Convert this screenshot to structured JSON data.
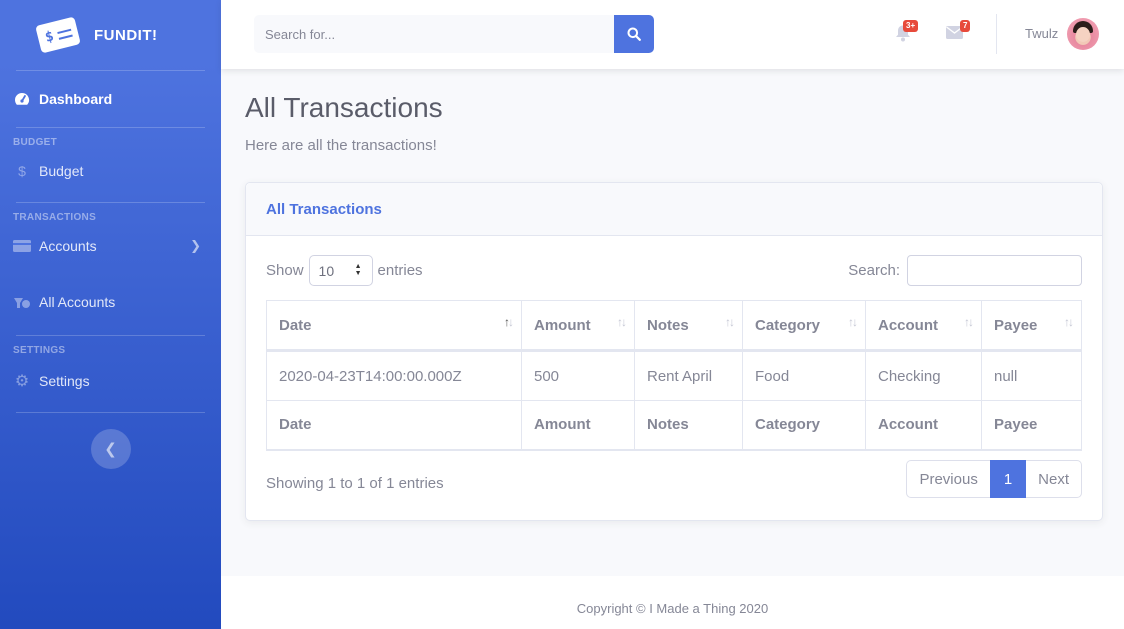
{
  "brand": {
    "name": "FUNDIT!",
    "logo_symbol": "$"
  },
  "sidebar": {
    "dashboard": "Dashboard",
    "heading_budget": "BUDGET",
    "budget": "Budget",
    "heading_transactions": "TRANSACTIONS",
    "accounts": "Accounts",
    "all_accounts": "All Accounts",
    "heading_settings": "SETTINGS",
    "settings": "Settings"
  },
  "topbar": {
    "search_placeholder": "Search for...",
    "alerts_badge": "3+",
    "messages_badge": "7",
    "user_name": "Twulz"
  },
  "page": {
    "title": "All Transactions",
    "subtitle": "Here are all the transactions!"
  },
  "card": {
    "header": "All Transactions",
    "show_label": "Show",
    "entries_value": "10",
    "entries_label": "entries",
    "search_label": "Search:",
    "columns": [
      "Date",
      "Amount",
      "Notes",
      "Category",
      "Account",
      "Payee"
    ],
    "rows": [
      [
        "2020-04-23T14:00:00.000Z",
        "500",
        "Rent April",
        "Food",
        "Checking",
        "null"
      ]
    ],
    "info": "Showing 1 to 1 of 1 entries",
    "pager": {
      "previous": "Previous",
      "current": "1",
      "next": "Next"
    }
  },
  "footer": {
    "copyright": "Copyright © I Made a Thing 2020"
  },
  "colors": {
    "primary": "#4e73df",
    "danger": "#e74a3b",
    "text": "#858796"
  },
  "icons": {
    "dashboard": "tachometer-icon",
    "budget": "dollar-icon",
    "accounts": "credit-card-icon",
    "all_accounts": "piggy-icon",
    "settings": "gear-icon",
    "search": "search-icon",
    "alerts": "bell-icon",
    "messages": "envelope-icon",
    "toggle": "chevron-left-icon"
  }
}
